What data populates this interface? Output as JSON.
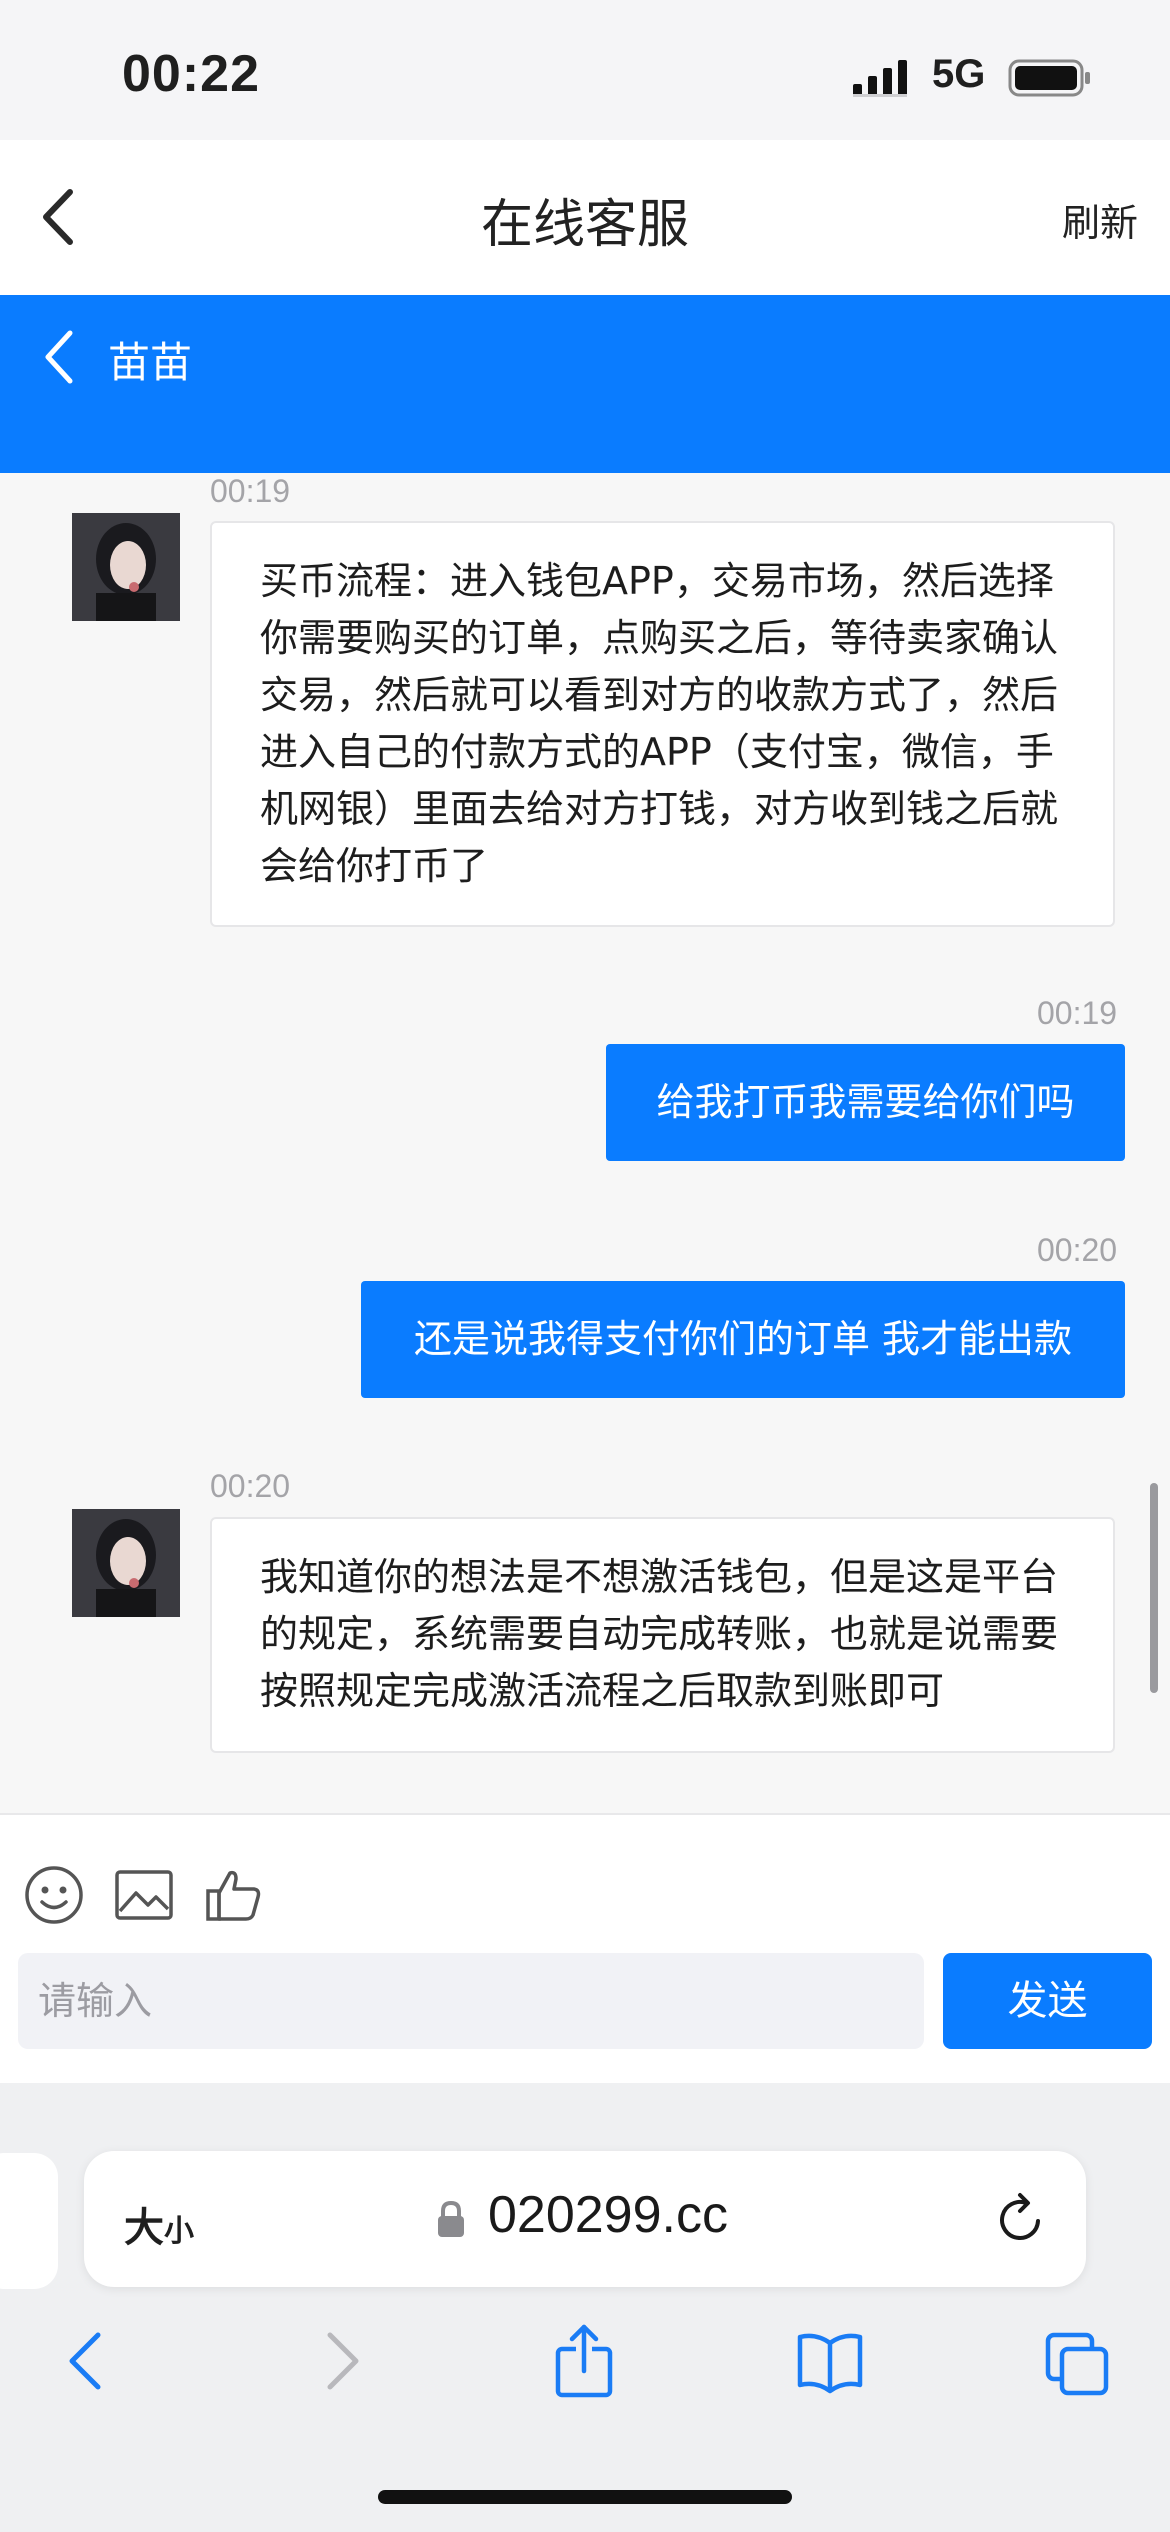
{
  "status_bar": {
    "time": "00:22",
    "network": "5G"
  },
  "nav": {
    "title": "在线客服",
    "refresh_label": "刷新"
  },
  "chat": {
    "agent_name": "苗苗"
  },
  "messages": [
    {
      "direction": "in",
      "time": "00:19",
      "text": "买币流程：进入钱包APP，交易市场，然后选择你需要购买的订单，点购买之后，等待卖家确认交易，然后就可以看到对方的收款方式了，然后进入自己的付款方式的APP（支付宝，微信，手机网银）里面去给对方打钱，对方收到钱之后就会给你打币了"
    },
    {
      "direction": "out",
      "time": "00:19",
      "text": "给我打币我需要给你们吗"
    },
    {
      "direction": "out",
      "time": "00:20",
      "text": "还是说我得支付你们的订单 我才能出款"
    },
    {
      "direction": "in",
      "time": "00:20",
      "text": "我知道你的想法是不想激活钱包，但是这是平台的规定，系统需要自动完成转账，也就是说需要按照规定完成激活流程之后取款到账即可"
    }
  ],
  "composer": {
    "placeholder": "请输入",
    "send_label": "发送",
    "tools": [
      "emoji-icon",
      "image-icon",
      "thumbs-up-icon"
    ]
  },
  "browser": {
    "text_size_big": "大",
    "text_size_small": "小",
    "url": "020299.cc"
  },
  "colors": {
    "accent": "#0a7cff",
    "background": "#f7f7f7"
  }
}
